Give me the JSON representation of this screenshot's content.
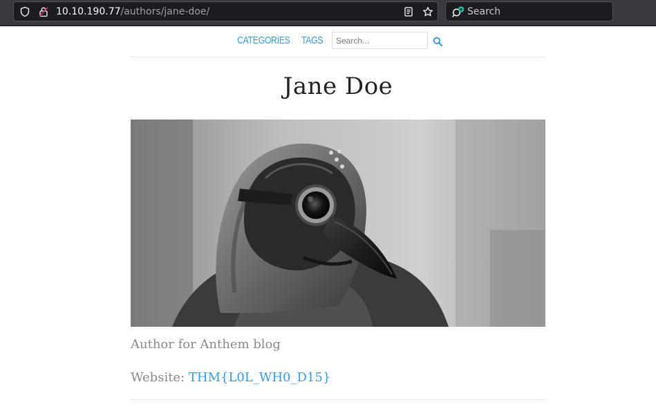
{
  "browser": {
    "url_host": "10.10.190.77",
    "url_path": "/authors/jane-doe/",
    "search_placeholder": "Search",
    "icons": [
      "shield-icon",
      "insecure-lock-icon",
      "reader-mode-icon",
      "bookmark-star-icon",
      "search-engine-icon"
    ]
  },
  "nav": {
    "categories_label": "CATEGORIES",
    "tags_label": "TAGS",
    "search_placeholder": "Search...",
    "search_icon": "magnifier-icon",
    "link_color": "#3a9bdc"
  },
  "author": {
    "name": "Jane Doe",
    "photo_alt": "plague-doctor-mask-photo",
    "bio": "Author for Anthem blog",
    "website_label": "Website:",
    "website_value": "THM{L0L_WH0_D15}"
  }
}
